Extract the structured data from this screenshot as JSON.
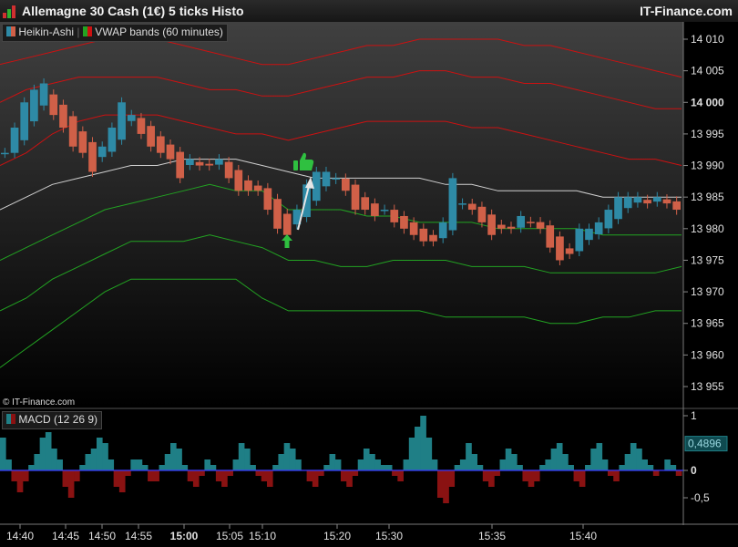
{
  "window": {
    "title": "Allemagne 30 Cash (1€) 5 ticks Histo",
    "brand": "IT-Finance.com",
    "credit": "© IT-Finance.com"
  },
  "legend": {
    "heikin": "Heikin-Ashi",
    "vwap": "VWAP bands (60 minutes)",
    "macd": "MACD (12 26 9)"
  },
  "colors": {
    "bull": "#2e8aa6",
    "bear": "#d06048",
    "upper_band": "#cc1111",
    "vwap_line": "#d0d0d0",
    "lower_band": "#22a322",
    "macd_pos": "#1f7f86",
    "macd_neg": "#8a1212",
    "signal_icon": "#2fc040"
  },
  "icons": [
    "thumbs-up-icon",
    "up-arrow-icon"
  ],
  "chart_data": [
    {
      "type": "line",
      "title": "Allemagne 30 Cash (1€) 5 ticks Histo",
      "price_axis": {
        "ticks": [
          {
            "value": 14010,
            "label": "14 010"
          },
          {
            "value": 14005,
            "label": "14 005"
          },
          {
            "value": 14000,
            "label": "14 000",
            "bold": true
          },
          {
            "value": 13995,
            "label": "13 995"
          },
          {
            "value": 13990,
            "label": "13 990"
          },
          {
            "value": 13985,
            "label": "13 985"
          },
          {
            "value": 13980,
            "label": "13 980"
          },
          {
            "value": 13975,
            "label": "13 975"
          },
          {
            "value": 13970,
            "label": "13 970"
          },
          {
            "value": 13965,
            "label": "13 965"
          },
          {
            "value": 13960,
            "label": "13 960"
          },
          {
            "value": 13955,
            "label": "13 955"
          }
        ]
      },
      "time_axis": [
        {
          "label": "14:40"
        },
        {
          "label": "14:45"
        },
        {
          "label": "14:50"
        },
        {
          "label": "14:55"
        },
        {
          "label": "15:00",
          "bold": true
        },
        {
          "label": "15:05"
        },
        {
          "label": "15:10"
        },
        {
          "label": "15:20"
        },
        {
          "label": "15:30"
        },
        {
          "label": "15:35"
        },
        {
          "label": "15:40"
        }
      ],
      "series": [
        {
          "name": "Heikin-Ashi",
          "kind": "candles",
          "close": [
            13992,
            13996,
            14000,
            14002,
            14003,
            13998,
            13996,
            13993,
            13992,
            13989,
            13993,
            13996,
            14000,
            13998,
            13995,
            13993,
            13992,
            13991,
            13988,
            13991,
            13990,
            13990,
            13991,
            13988,
            13986,
            13986,
            13986,
            13983,
            13980,
            13979,
            13983,
            13987,
            13989,
            13989,
            13988,
            13986,
            13983,
            13983,
            13982,
            13983,
            13981,
            13980,
            13979,
            13978,
            13978,
            13981,
            13988,
            13984,
            13983,
            13981,
            13979,
            13980,
            13980,
            13982,
            13981,
            13980,
            13977,
            13975,
            13976,
            13980,
            13980,
            13981,
            13983,
            13985,
            13985,
            13985,
            13984,
            13985,
            13984,
            13983
          ]
        }
      ],
      "bands": [
        {
          "name": "VWAP bands (60 minutes)",
          "role": "upper-3",
          "values": [
            14006,
            14007,
            14008,
            14009,
            14010,
            14010,
            14010,
            14009,
            14008,
            14007,
            14006,
            14006,
            14007,
            14008,
            14009,
            14009,
            14010,
            14010,
            14010,
            14010,
            14009,
            14009,
            14008,
            14007,
            14006,
            14005,
            14004
          ]
        },
        {
          "role": "upper-2",
          "values": [
            14000,
            14002,
            14003,
            14004,
            14004,
            14004,
            14004,
            14003,
            14002,
            14002,
            14001,
            14001,
            14002,
            14003,
            14004,
            14004,
            14005,
            14005,
            14004,
            14004,
            14003,
            14003,
            14002,
            14001,
            14000,
            13999,
            13999
          ]
        },
        {
          "role": "upper-1",
          "values": [
            13990,
            13992,
            13995,
            13997,
            13998,
            13998,
            13998,
            13997,
            13996,
            13995,
            13995,
            13994,
            13995,
            13996,
            13997,
            13997,
            13997,
            13997,
            13996,
            13996,
            13995,
            13994,
            13993,
            13992,
            13991,
            13991,
            13990
          ]
        },
        {
          "role": "vwap",
          "values": [
            13983,
            13985,
            13987,
            13988,
            13989,
            13990,
            13990,
            13991,
            13991,
            13991,
            13990,
            13989,
            13988,
            13988,
            13988,
            13988,
            13988,
            13987,
            13987,
            13986,
            13986,
            13986,
            13986,
            13985,
            13985,
            13985,
            13985
          ]
        },
        {
          "role": "lower-1",
          "values": [
            13975,
            13977,
            13979,
            13981,
            13983,
            13984,
            13985,
            13986,
            13987,
            13986,
            13986,
            13983,
            13983,
            13983,
            13982,
            13982,
            13981,
            13981,
            13981,
            13980,
            13980,
            13980,
            13980,
            13979,
            13979,
            13979,
            13979
          ]
        },
        {
          "role": "lower-2",
          "values": [
            13967,
            13969,
            13972,
            13974,
            13976,
            13978,
            13978,
            13978,
            13979,
            13978,
            13977,
            13975,
            13975,
            13974,
            13974,
            13975,
            13975,
            13975,
            13974,
            13974,
            13974,
            13973,
            13973,
            13973,
            13973,
            13973,
            13974
          ]
        },
        {
          "role": "lower-3",
          "values": [
            13958,
            13961,
            13964,
            13967,
            13970,
            13972,
            13972,
            13972,
            13972,
            13972,
            13969,
            13967,
            13967,
            13967,
            13967,
            13967,
            13967,
            13966,
            13966,
            13966,
            13966,
            13965,
            13965,
            13966,
            13966,
            13967,
            13967
          ]
        }
      ]
    },
    {
      "type": "bar",
      "title": "MACD (12 26 9)",
      "y_ticks": [
        {
          "value": 1,
          "label": "1"
        },
        {
          "value": 0,
          "label": "0",
          "bold": true
        },
        {
          "value": -0.5,
          "label": "-0,5"
        }
      ],
      "last_value": "0,4896",
      "values": [
        0.6,
        0.2,
        -0.2,
        -0.4,
        -0.2,
        0.1,
        0.3,
        0.6,
        0.7,
        0.4,
        0.2,
        -0.3,
        -0.5,
        -0.2,
        0.1,
        0.3,
        0.4,
        0.6,
        0.5,
        0.2,
        -0.3,
        -0.4,
        -0.1,
        0.2,
        0.2,
        0.1,
        -0.2,
        -0.2,
        0.1,
        0.3,
        0.5,
        0.4,
        0.1,
        -0.2,
        -0.3,
        -0.1,
        0.2,
        0.1,
        -0.2,
        -0.3,
        -0.1,
        0.2,
        0.5,
        0.4,
        0.1,
        -0.1,
        -0.2,
        -0.3,
        0.1,
        0.3,
        0.5,
        0.4,
        0.2,
        0.0,
        -0.2,
        -0.3,
        -0.1,
        0.1,
        0.3,
        0.2,
        -0.2,
        -0.3,
        -0.1,
        0.2,
        0.4,
        0.3,
        0.2,
        0.1,
        0.1,
        -0.1,
        -0.2,
        0.2,
        0.6,
        0.8,
        1.0,
        0.6,
        0.2,
        -0.5,
        -0.6,
        -0.3,
        0.1,
        0.2,
        0.5,
        0.3,
        0.1,
        -0.2,
        -0.3,
        -0.1,
        0.2,
        0.4,
        0.3,
        0.1,
        -0.2,
        -0.3,
        -0.2,
        0.1,
        0.2,
        0.4,
        0.5,
        0.3,
        0.1,
        -0.2,
        -0.3,
        0.1,
        0.4,
        0.5,
        0.2,
        -0.1,
        -0.2,
        0.1,
        0.3,
        0.5,
        0.4,
        0.2,
        0.1,
        -0.1,
        0.0,
        0.2,
        0.1,
        -0.1
      ]
    }
  ]
}
